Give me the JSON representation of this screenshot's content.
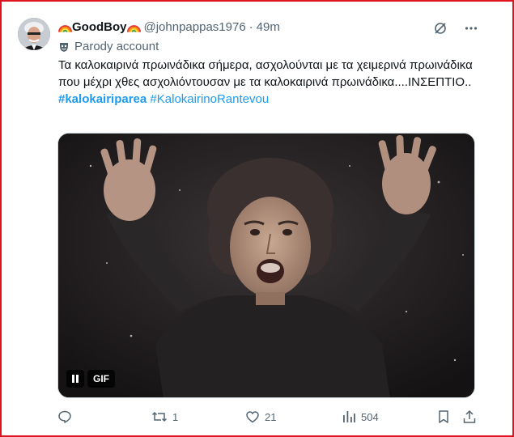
{
  "author": {
    "display_name": "GoodBoy",
    "handle": "@johnpappas1976",
    "separator": "·",
    "time": "49m",
    "label": "Parody account"
  },
  "tweet": {
    "text": "Τα καλοκαιρινά πρωινάδικα σήμερα, ασχολούνται με τα χειμερινά πρωινάδικα που μέχρι χθες ασχολιόντουσαν με τα καλοκαιρινά πρωινάδικα....ΙΝΣΕΠΤΙΟ..",
    "hashtag_1": "#kalokairiparea",
    "hashtag_2": "#KalokairinoRantevou"
  },
  "media": {
    "gif_label": "GIF"
  },
  "actions": {
    "replies": "",
    "retweets": "1",
    "likes": "21",
    "views": "504"
  },
  "colors": {
    "frame": "#e0141e",
    "link": "#1d9bf0",
    "muted": "#536471"
  },
  "icons": [
    "rainbow-emoji",
    "parody-mask-icon",
    "grok-icon",
    "more-icon",
    "pause-icon",
    "reply-icon",
    "retweet-icon",
    "like-icon",
    "views-icon",
    "bookmark-icon",
    "share-icon"
  ]
}
